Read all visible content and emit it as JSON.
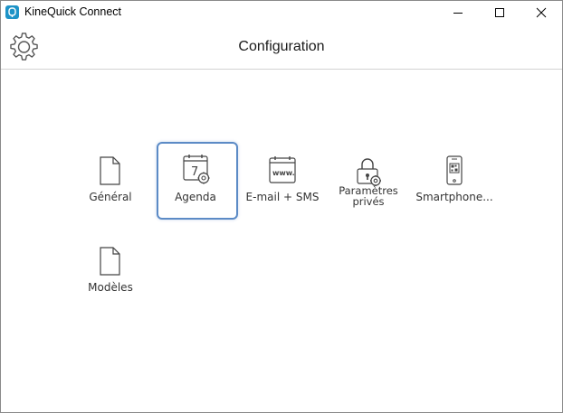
{
  "window": {
    "title": "KineQuick Connect",
    "accent": "#1d93c7"
  },
  "header": {
    "title": "Configuration",
    "settings_icon": "gear-icon"
  },
  "tiles": [
    {
      "label": "Général",
      "icon": "document-icon",
      "selected": false
    },
    {
      "label": "Agenda",
      "icon": "calendar-settings-icon",
      "selected": true
    },
    {
      "label": "E-mail + SMS",
      "icon": "web-calendar-icon",
      "selected": false
    },
    {
      "label": "Paramètres\nprivés",
      "icon": "lock-settings-icon",
      "selected": false
    },
    {
      "label": "Smartphone...",
      "icon": "smartphone-qr-icon",
      "selected": false
    },
    {
      "label": "Modèles",
      "icon": "document-icon",
      "selected": false
    }
  ],
  "colors": {
    "selection_border": "#5c8bc6",
    "icon_stroke": "#444444"
  }
}
